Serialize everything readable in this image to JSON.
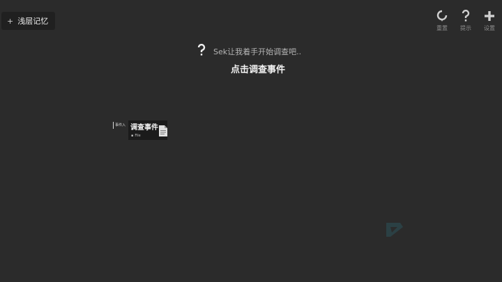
{
  "memory_button": {
    "icon": "plus-icon",
    "label": "浅层记忆"
  },
  "toolbar": {
    "items": [
      {
        "icon": "reset-icon",
        "label": "重置"
      },
      {
        "icon": "question-icon",
        "label": "提示"
      },
      {
        "icon": "plus-icon",
        "label": "设置"
      }
    ]
  },
  "hint": {
    "icon": "question-icon",
    "text": "Sek让我着手开始调查吧.."
  },
  "instruction": "点击调查事件",
  "event_card": {
    "tag": "事件入",
    "title": "调查事件",
    "subtitle": "File",
    "icon": "document-icon"
  },
  "watermark": {
    "icon": "logo-mark"
  },
  "colors": {
    "background": "#2b2b2b",
    "panel": "#1b1b1b",
    "text": "#f0f0f0",
    "muted": "#8c8c8c"
  }
}
